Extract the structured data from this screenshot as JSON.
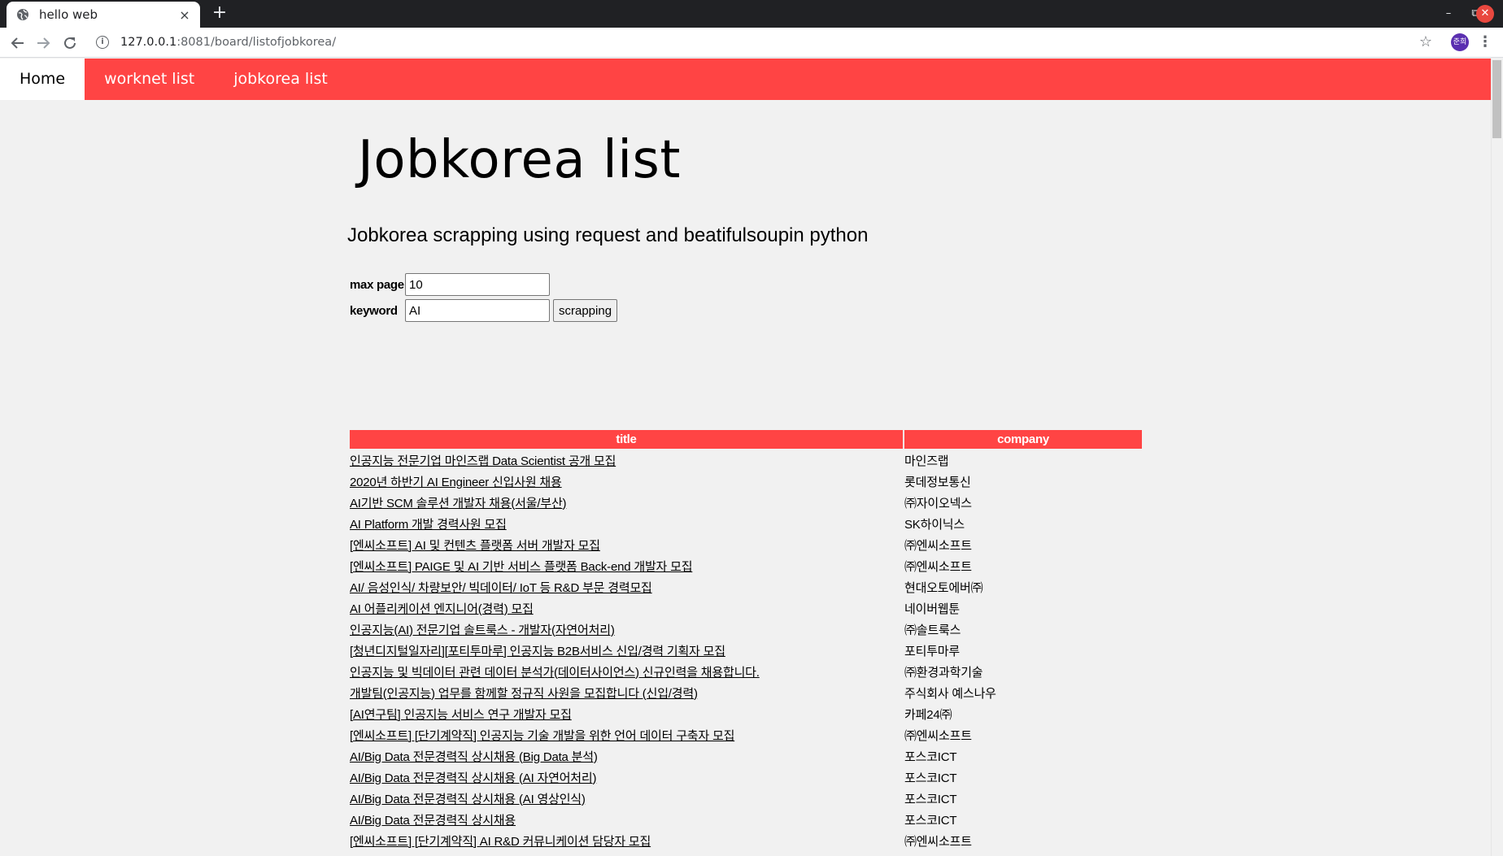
{
  "browser": {
    "tab_title": "hello web",
    "tab_close": "×",
    "new_tab": "+",
    "url_host": "127.0.0.1",
    "url_rest": ":8081/board/listofjobkorea/",
    "profile_initials": "준희",
    "window_controls": [
      "–",
      "⧉",
      "✕"
    ]
  },
  "nav": {
    "home": "Home",
    "worknet": "worknet list",
    "jobkorea": "jobkorea list"
  },
  "page": {
    "title": "Jobkorea list",
    "subtitle": "Jobkorea scrapping using request and beatifulsoupin python"
  },
  "form": {
    "max_page_label": "max page",
    "max_page_value": "10",
    "keyword_label": "keyword",
    "keyword_value": "AI",
    "submit_label": "scrapping"
  },
  "table": {
    "headers": [
      "title",
      "company"
    ],
    "rows": [
      {
        "title": "인공지능 전문기업 마인즈랩 Data Scientist 공개 모집",
        "company": "마인즈랩"
      },
      {
        "title": "2020년 하반기 AI Engineer 신입사원 채용",
        "company": "롯데정보통신"
      },
      {
        "title": "AI기반 SCM 솔루션 개발자 채용(서울/부산)",
        "company": "㈜자이오넥스"
      },
      {
        "title": "AI Platform 개발 경력사원 모집",
        "company": "SK하이닉스"
      },
      {
        "title": "[엔씨소프트] AI 및 컨텐츠 플랫폼 서버 개발자 모집",
        "company": "㈜엔씨소프트"
      },
      {
        "title": "[엔씨소프트] PAIGE 및 AI 기반 서비스 플랫폼 Back-end 개발자 모집",
        "company": "㈜엔씨소프트"
      },
      {
        "title": "AI/ 음성인식/ 차량보안/ 빅데이터/ IoT 등 R&D 부문 경력모집",
        "company": "현대오토에버㈜"
      },
      {
        "title": "AI 어플리케이션 엔지니어(경력) 모집",
        "company": "네이버웹툰"
      },
      {
        "title": "인공지능(AI) 전문기업 솔트룩스 - 개발자(자연어처리)",
        "company": "㈜솔트룩스"
      },
      {
        "title": "[청년디지털일자리][포티투마루] 인공지능 B2B서비스 신입/경력 기획자 모집",
        "company": "포티투마루"
      },
      {
        "title": "인공지능 및 빅데이터 관련 데이터 분석가(데이터사이언스) 신규인력을 채용합니다.",
        "company": "㈜환경과학기술"
      },
      {
        "title": "개발팀(인공지능) 업무를 함께할 정규직 사원을 모집합니다 (신입/경력)",
        "company": "주식회사 예스나우"
      },
      {
        "title": "[AI연구팀] 인공지능 서비스 연구 개발자 모집",
        "company": "카페24㈜"
      },
      {
        "title": "[엔씨소프트] [단기계약직] 인공지능 기술 개발을 위한 언어 데이터 구축자 모집",
        "company": "㈜엔씨소프트"
      },
      {
        "title": "AI/Big Data 전문경력직 상시채용 (Big Data 분석)",
        "company": "포스코ICT"
      },
      {
        "title": "AI/Big Data 전문경력직 상시채용 (AI 자연어처리)",
        "company": "포스코ICT"
      },
      {
        "title": "AI/Big Data 전문경력직 상시채용 (AI 영상인식)",
        "company": "포스코ICT"
      },
      {
        "title": "AI/Big Data 전문경력직 상시채용",
        "company": "포스코ICT"
      },
      {
        "title": "[엔씨소프트] [단기계약직] AI R&D 커뮤니케이션 담당자 모집",
        "company": "㈜엔씨소프트"
      }
    ]
  },
  "colors": {
    "accent": "#ff4444",
    "chrome_dark": "#202124"
  },
  "icons": [
    "globe-icon",
    "back-arrow-icon",
    "forward-arrow-icon",
    "reload-icon",
    "info-icon",
    "star-icon",
    "kebab-menu-icon"
  ]
}
